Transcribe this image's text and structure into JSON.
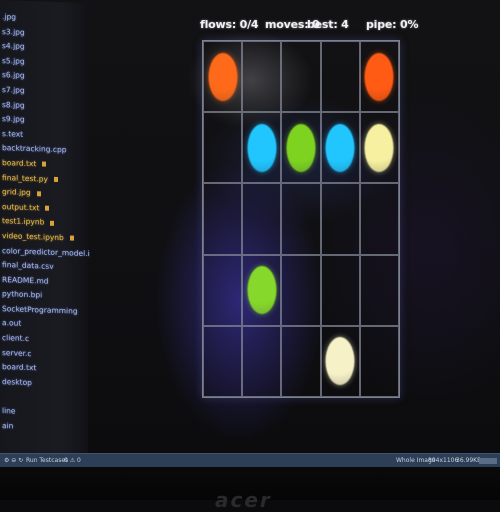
{
  "header": {
    "flows": "flows: 0/4",
    "moves": "moves: 0",
    "best": "best: 4",
    "pipe": "pipe: 0%"
  },
  "board": {
    "rows": 5,
    "cols": 5,
    "dots": [
      {
        "row": 0,
        "col": 0,
        "color": "#ff6a1a"
      },
      {
        "row": 0,
        "col": 4,
        "color": "#ff5b14"
      },
      {
        "row": 1,
        "col": 1,
        "color": "#22c6ff"
      },
      {
        "row": 1,
        "col": 2,
        "color": "#7ed321"
      },
      {
        "row": 1,
        "col": 3,
        "color": "#22c6ff"
      },
      {
        "row": 1,
        "col": 4,
        "color": "#f6f0a0"
      },
      {
        "row": 3,
        "col": 1,
        "color": "#86d82a"
      },
      {
        "row": 4,
        "col": 3,
        "color": "#f7f1c8"
      }
    ]
  },
  "sidebar": {
    "files": [
      {
        "label": ".jpg",
        "modified": false
      },
      {
        "label": "s3.jpg",
        "modified": false
      },
      {
        "label": "s4.jpg",
        "modified": false
      },
      {
        "label": "s5.jpg",
        "modified": false
      },
      {
        "label": "s6.jpg",
        "modified": false
      },
      {
        "label": "s7.jpg",
        "modified": false
      },
      {
        "label": "s8.jpg",
        "modified": false
      },
      {
        "label": "s9.jpg",
        "modified": false
      },
      {
        "label": "s.text",
        "modified": false
      },
      {
        "label": "backtracking.cpp",
        "modified": false
      },
      {
        "label": "board.txt",
        "modified": true
      },
      {
        "label": "final_test.py",
        "modified": true
      },
      {
        "label": "grid.jpg",
        "modified": true
      },
      {
        "label": "output.txt",
        "modified": true
      },
      {
        "label": "test1.ipynb",
        "modified": true
      },
      {
        "label": "video_test.ipynb",
        "modified": true
      },
      {
        "label": "color_predictor_model.ipynb",
        "modified": false
      },
      {
        "label": "final_data.csv",
        "modified": false
      },
      {
        "label": "README.md",
        "modified": false
      },
      {
        "label": "python.bpi",
        "modified": false
      },
      {
        "label": "SocketProgramming",
        "modified": false
      },
      {
        "label": "a.out",
        "modified": false
      },
      {
        "label": "client.c",
        "modified": false
      },
      {
        "label": "server.c",
        "modified": false
      },
      {
        "label": "board.txt",
        "modified": false
      },
      {
        "label": "desktop",
        "modified": false
      },
      {
        "label": "",
        "modified": false
      },
      {
        "label": "line",
        "modified": false
      },
      {
        "label": "ain",
        "modified": false
      }
    ]
  },
  "statusbar": {
    "left": "Run Testcases",
    "left2": "0 ⚠ 0",
    "right1": "Whole Image",
    "right2": "894x1106",
    "right3": "36.99KB"
  },
  "brand": "acer"
}
